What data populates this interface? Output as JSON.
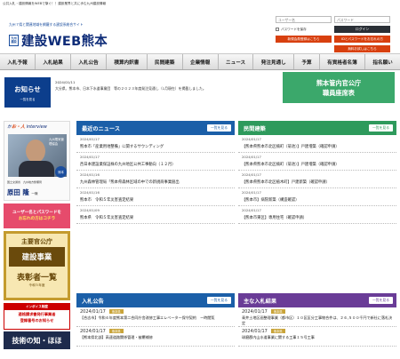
{
  "topbar": {
    "text": "公共入札・建設情報をWEBで繋ぐ！！建設業界と共に歩む九州建設情報"
  },
  "header": {
    "tagline": "九州７県と関連地域を網羅する建設系総合サイト",
    "logo_mark": "九州建設",
    "logo_text": "建設WEB熊本"
  },
  "login": {
    "user_placeholder": "ユーザー名",
    "pass_placeholder": "パスワード",
    "remember_label": "パスワードを保存",
    "login_label": "ログイン",
    "register_label": "新規会員登録はこちら",
    "forgot_label": "IDとパスワードをお忘れの方",
    "trial_label": "無料お試しはこちら"
  },
  "nav": [
    "入札予報",
    "入札結果",
    "入札公告",
    "積算内訳書",
    "民間建築",
    "企業情報",
    "ニュース",
    "発注見通し",
    "予算",
    "有資格者名簿",
    "指名願い"
  ],
  "notice": {
    "label": "お知らせ",
    "more": "一覧を見る",
    "date": "2024/01/11",
    "text": "大分県、熊本市、日本下水道事業団　等の２０２３年度発注見通し（1月現在）を掲載しました。"
  },
  "gov_box": {
    "line1": "熊本管内官公庁",
    "line2": "職員座席表"
  },
  "sidebar": {
    "interview_title_a": "か",
    "interview_title_hito": "お・人",
    "interview_title_b": "interview",
    "photo_caption": "九州電気管理協会",
    "badge": "熊本",
    "company": "国土交通省　九州地方整備局",
    "name": "原田 隆",
    "honor": "一様",
    "pw_line1": "ユーザー名とパスワードを",
    "pw_line2": "お忘れの方はコチラ",
    "kouji_t1": "主要官公庁",
    "kouji_t2": "建設事業",
    "kouji_t3": "表彰者一覧",
    "kouji_t4": "令和５年度",
    "inv_top": "インボイス制度",
    "inv_line1": "適格請求書発行事業者",
    "inv_line2": "登録番号のお知らせ",
    "dark": "技術の知・ほほ"
  },
  "news": {
    "title": "最近のニュース",
    "more": "一覧を見る",
    "items": [
      {
        "date": "2024/01/17",
        "text": "熊本市「産業用地整備」に関するサウンディング"
      },
      {
        "date": "2024/01/17",
        "text": "西日本建設業保証株の九州地区公共工事動向（１２月）"
      },
      {
        "date": "2024/01/16",
        "text": "九州森林管理局「熊本県森林区域の中での新規商事業創出"
      },
      {
        "date": "2024/01/16",
        "text": "熊本市　令和５年災害査定結果"
      },
      {
        "date": "2024/01/09",
        "text": "熊本県　令和５年災害査定結果"
      }
    ]
  },
  "private": {
    "title": "民間建築",
    "more": "一覧を見る",
    "items": [
      {
        "date": "2024/01/17",
        "text": "【熊本県熊本市北区楠町（菊池）】戸建増築（確認申請）"
      },
      {
        "date": "2024/01/17",
        "text": "【熊本県熊本市北区楠町（菊池）】戸建増築（確認申請）"
      },
      {
        "date": "2024/01/17",
        "text": "【熊本県熊本市北区植木町】戸建新築（確認申請）"
      },
      {
        "date": "2024/01/17",
        "text": "【熊本市】病院新築（構造確認）"
      },
      {
        "date": "2024/01/17",
        "text": "【熊本市東区】専用住宅（確認申請）"
      }
    ]
  },
  "bid_notice": {
    "title": "入札公告",
    "more": "一覧を見る",
    "items": [
      {
        "date": "2024/01/17",
        "tag": "熊本県",
        "text": "【合志市】令和６年度熊本第二合同庁舎改修工事エレベーター保守契約　ー時閲覧"
      },
      {
        "date": "2024/01/17",
        "tag": "熊本県",
        "text": "【熊本県北部】高速道路関係管理・被覆補修"
      }
    ]
  },
  "bid_result": {
    "title": "主な入札結果",
    "more": "一覧を見る",
    "items": [
      {
        "date": "2024/01/17",
        "tag": "熊本県",
        "text": "青井土地区画整理事業（都市区）１０区区分工事物合件は、２６,５００千円で新社に落札決定"
      },
      {
        "date": "2024/01/17",
        "tag": "熊本県",
        "text": "球磨郡内山水道事業に関する工事１５号工事"
      }
    ]
  }
}
